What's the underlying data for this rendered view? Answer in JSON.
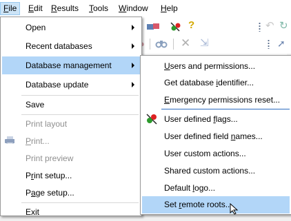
{
  "menubar": {
    "items": [
      {
        "label": "File",
        "accel": "F",
        "rest": "ile",
        "active": true
      },
      {
        "label": "Edit",
        "accel": "E",
        "rest": "dit"
      },
      {
        "label": "Results",
        "accel": "R",
        "rest": "esults"
      },
      {
        "label": "Tools",
        "accel": "T",
        "rest": "ools"
      },
      {
        "label": "Window",
        "accel": "W",
        "rest": "indow"
      },
      {
        "label": "Help",
        "accel": "H",
        "rest": "elp"
      }
    ]
  },
  "file_menu": {
    "items": [
      {
        "label": "Open",
        "has_submenu": true
      },
      {
        "label": "Recent databases",
        "has_submenu": true
      },
      {
        "label": "Database management",
        "has_submenu": true,
        "highlighted": true
      },
      {
        "label": "Database update",
        "has_submenu": true
      },
      {
        "label": "Save"
      },
      {
        "label": "Print layout",
        "disabled": true
      },
      {
        "pre": "",
        "accel": "P",
        "post": "rint...",
        "disabled": true,
        "icon": "printer-icon"
      },
      {
        "label": "Print preview",
        "disabled": true
      },
      {
        "pre": "P",
        "accel": "r",
        "post": "int setup..."
      },
      {
        "pre": "P",
        "accel": "a",
        "post": "ge setup..."
      },
      {
        "label": "Exit"
      }
    ]
  },
  "submenu": {
    "items": [
      {
        "pre": "",
        "accel": "U",
        "post": "sers and permissions..."
      },
      {
        "pre": "Get database ",
        "accel": "i",
        "post": "dentifier..."
      },
      {
        "pre": "",
        "accel": "E",
        "post": "mergency permissions reset..."
      },
      {
        "pre": "User defined ",
        "accel": "f",
        "post": "lags...",
        "icon": "flag-icon"
      },
      {
        "pre": "User defined field ",
        "accel": "n",
        "post": "ames..."
      },
      {
        "label": "User custom actions..."
      },
      {
        "label": "Shared custom actions..."
      },
      {
        "pre": "Default ",
        "accel": "l",
        "post": "ogo..."
      },
      {
        "pre": "Set ",
        "accel": "r",
        "post": "emote roots...",
        "highlighted": true
      }
    ]
  },
  "colors": {
    "highlight": "#b2d6f8",
    "menubar_active": "#cce4f7",
    "separator_blue": "#2c6bc0"
  }
}
